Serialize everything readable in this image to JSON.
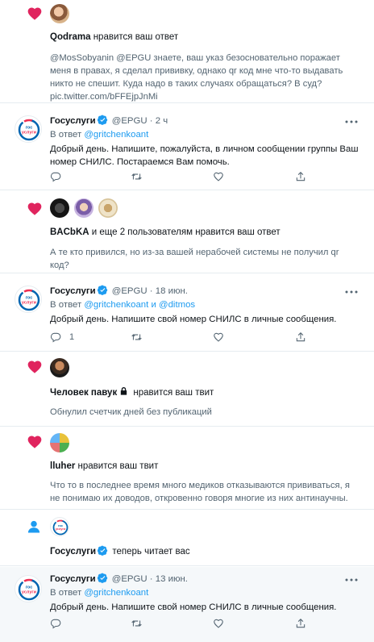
{
  "colors": {
    "heart": "#e0245e",
    "link": "#1d9bf0",
    "muted": "#536471",
    "text": "#0f1419",
    "divider": "#e6ecf0",
    "highlight": "#f5f8fa"
  },
  "n1": {
    "user": "Qodrama",
    "action": "нравится ваш ответ",
    "quote": [
      "@MosSobyanin  @EPGU  знаете, ваш указ безосновательно поражает",
      "меня в правах, я сделал прививку, однако qr код мне что-то выдавать",
      "никто не спешит. Куда надо в таких случаях обращаться? В суд?",
      "pic.twitter.com/bFFEjpJnMi"
    ]
  },
  "t1": {
    "name": "Госуслуги",
    "handle": "@EPGU",
    "sep": "·",
    "time": "2 ч",
    "reply_prefix": "В ответ",
    "reply_to": "@gritchenkoant",
    "text": [
      "Добрый день. Напишите, пожалуйста, в личном сообщении группы Ваш",
      "номер СНИЛС. Постараемся Вам помочь."
    ],
    "reply_count": "",
    "retweet_count": "",
    "like_count": ""
  },
  "n2": {
    "user": "BACbKA",
    "action": "и еще 2 пользователям нравится ваш ответ",
    "quote": [
      "А те кто привился, но из-за вашей нерабочей системы не получил qr",
      "код?"
    ]
  },
  "t2": {
    "name": "Госуслуги",
    "handle": "@EPGU",
    "sep": "·",
    "time": "18 июн.",
    "reply_prefix": "В ответ",
    "reply_to": "@gritchenkoant",
    "reply_and": "и",
    "reply_to2": "@ditmos",
    "text": [
      "Добрый день. Напишите свой номер СНИЛС в личные сообщения."
    ],
    "reply_count": "1"
  },
  "n3": {
    "user": "Человек павук",
    "action": "нравится ваш твит",
    "quote": [
      "Обнулил счетчик дней без публикаций"
    ]
  },
  "n4": {
    "user": "lluher",
    "action": "нравится ваш твит",
    "quote": [
      "Что то в последнее время много медиков отказываются прививаться, я",
      "не понимаю их доводов, откровенно говоря многие из них антинаучны."
    ]
  },
  "n5": {
    "user": "Госуслуги",
    "action": "теперь читает вас"
  },
  "t3": {
    "name": "Госуслуги",
    "handle": "@EPGU",
    "sep": "·",
    "time": "13 июн.",
    "reply_prefix": "В ответ",
    "reply_to": "@gritchenkoant",
    "text": [
      "Добрый день. Напишите свой номер СНИЛС в личные сообщения."
    ]
  },
  "logo": {
    "line1": "гос",
    "line2": "услуги"
  },
  "icons": [
    "heart-icon",
    "verified-icon",
    "more-icon",
    "reply-icon",
    "retweet-icon",
    "like-icon",
    "share-icon",
    "lock-icon",
    "person-icon",
    "gosuslugi-logo"
  ]
}
